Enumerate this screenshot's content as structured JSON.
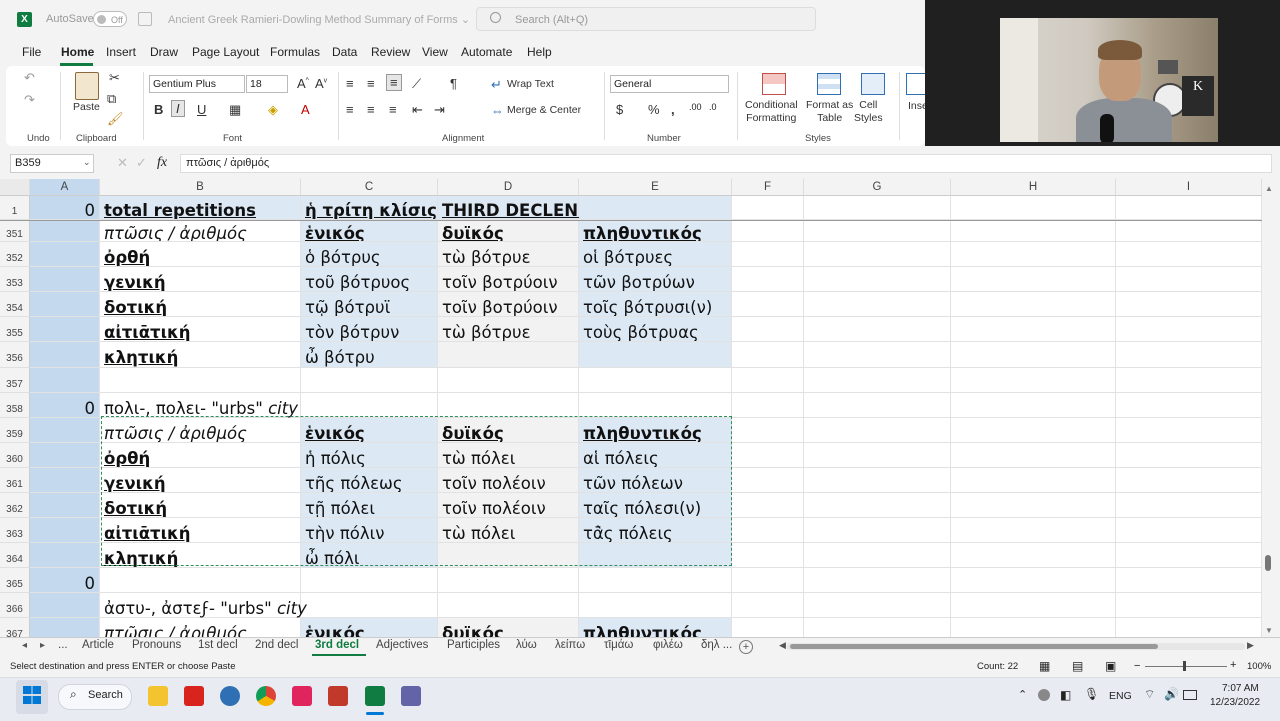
{
  "titlebar": {
    "autosave_label": "AutoSave",
    "autosave_state": "Off",
    "document_title": "Ancient Greek Ramieri-Dowling Method Summary of Forms",
    "search_placeholder": "Search (Alt+Q)"
  },
  "menu": [
    "File",
    "Home",
    "Insert",
    "Draw",
    "Page Layout",
    "Formulas",
    "Data",
    "Review",
    "View",
    "Automate",
    "Help"
  ],
  "menu_active": "Home",
  "ribbon": {
    "undo_label": "Undo",
    "paste_label": "Paste",
    "clipboard_label": "Clipboard",
    "font_name": "Gentium Plus",
    "font_size": "18",
    "font_label": "Font",
    "wrap_text": "Wrap Text",
    "merge_center": "Merge & Center",
    "alignment_label": "Alignment",
    "number_format": "General",
    "number_label": "Number",
    "conditional_formatting": "Conditional\nFormatting",
    "format_as_table": "Format as\nTable",
    "cell_styles": "Cell\nStyles",
    "styles_label": "Styles",
    "insert_label": "Inse"
  },
  "formula_bar": {
    "name_box": "B359",
    "fx": "fx",
    "content": "πτῶσις / ἀριθμός"
  },
  "columns": [
    "A",
    "B",
    "C",
    "D",
    "E",
    "F",
    "G",
    "H",
    "I"
  ],
  "rows": [
    {
      "n": "1",
      "a": "0",
      "b": "total repetitions",
      "c": "ἡ τρίτη κλίσις",
      "d": "THIRD DECLENSION",
      "e": ""
    },
    {
      "n": "351",
      "a": "",
      "b": "πτῶσις / ἀριθμός",
      "c": "ἑνικός",
      "d": "δυϊκός",
      "e": "πληθυντικός"
    },
    {
      "n": "352",
      "a": "",
      "b": "ὀρθή",
      "c": "ὁ βότρυς",
      "d": "τὼ βότρυε",
      "e": "οἱ βότρυες"
    },
    {
      "n": "353",
      "a": "",
      "b": "γενική",
      "c": "τοῦ βότρυος",
      "d": "τοῖν βοτρύοιν",
      "e": "τῶν βοτρύων"
    },
    {
      "n": "354",
      "a": "",
      "b": "δοτική",
      "c": "τῷ βότρυϊ",
      "d": "τοῖν βοτρύοιν",
      "e": "τοῖς βότρυσι(ν)"
    },
    {
      "n": "355",
      "a": "",
      "b": "αἰτιᾱτική",
      "c": "τὸν βότρυν",
      "d": "τὼ βότρυε",
      "e": "τοὺς βότρυας"
    },
    {
      "n": "356",
      "a": "",
      "b": "κλητική",
      "c": "ὦ βότρυ",
      "d": "",
      "e": ""
    },
    {
      "n": "357",
      "a": "",
      "b": "",
      "c": "",
      "d": "",
      "e": ""
    },
    {
      "n": "358",
      "a": "0",
      "b": "πολι-, πολει- \"urbs\" city",
      "c": "",
      "d": "",
      "e": ""
    },
    {
      "n": "359",
      "a": "",
      "b": "πτῶσις / ἀριθμός",
      "c": "ἑνικός",
      "d": "δυϊκός",
      "e": "πληθυντικός"
    },
    {
      "n": "360",
      "a": "",
      "b": "ὀρθή",
      "c": "ἡ πόλις",
      "d": "τὼ πόλει",
      "e": "αἱ πόλεις"
    },
    {
      "n": "361",
      "a": "",
      "b": "γενική",
      "c": "τῆς πόλεως",
      "d": "τοῖν πολέοιν",
      "e": "τῶν πόλεων"
    },
    {
      "n": "362",
      "a": "",
      "b": "δοτική",
      "c": "τῇ πόλει",
      "d": "τοῖν πολέοιν",
      "e": "ταῖς πόλεσι(ν)"
    },
    {
      "n": "363",
      "a": "",
      "b": "αἰτιᾱτική",
      "c": "τὴν πόλιν",
      "d": "τὼ πόλει",
      "e": "τᾱ̀ς πόλεις"
    },
    {
      "n": "364",
      "a": "",
      "b": "κλητική",
      "c": "ὦ πόλι",
      "d": "",
      "e": ""
    },
    {
      "n": "365",
      "a": "0",
      "b": "",
      "c": "",
      "d": "",
      "e": ""
    },
    {
      "n": "366",
      "a": "",
      "b": "ἀστυ-, ἀστεϝ- \"urbs\" city",
      "c": "",
      "d": "",
      "e": ""
    },
    {
      "n": "367",
      "a": "",
      "b": "πτῶσις / ἀριθμός",
      "c": "ἑνικός",
      "d": "δυϊκός",
      "e": "πληθυντικός"
    }
  ],
  "sheet_tabs": [
    "...",
    "Article",
    "Pronouns",
    "1st decl",
    "2nd decl",
    "3rd decl",
    "Adjectives",
    "Participles",
    "λύω",
    "λείπω",
    "τῑμάω",
    "φιλέω",
    "δηλ ..."
  ],
  "active_sheet": "3rd decl",
  "status": {
    "message": "Select destination and press ENTER or choose Paste",
    "count": "Count: 22",
    "zoom": "100%"
  },
  "taskbar": {
    "search_label": "Search",
    "language": "ENG",
    "time": "7:07 AM",
    "date": "12/23/2022"
  },
  "colors": {
    "excel_green": "#107c41",
    "header_blue": "#dce9f5",
    "marquee": "#2f8f5a"
  }
}
